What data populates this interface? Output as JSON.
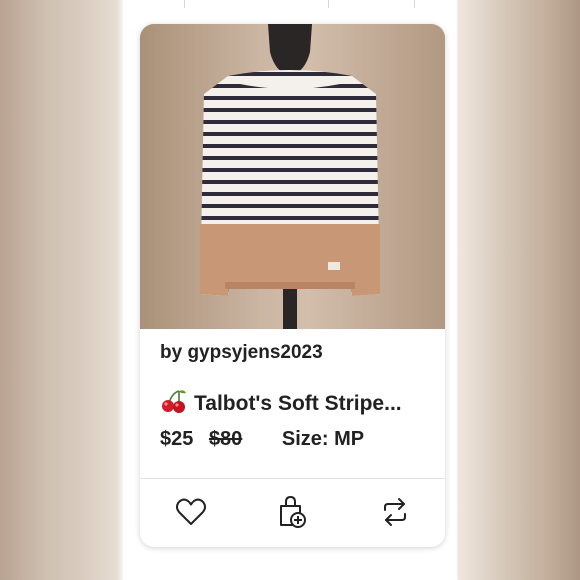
{
  "listing": {
    "seller": "by gypsyjens2023",
    "title_emoji": "cherry-icon",
    "title": "Talbot's Soft Stripe...",
    "price": "$25",
    "original_price": "$80",
    "size_label": "Size: MP"
  },
  "actions": [
    "like-heart-icon",
    "add-to-bundle-icon",
    "share-icon"
  ],
  "colors": {
    "sweater_stripe": "#2f2b3a",
    "sweater_base": "#f4f1ec",
    "sweater_hem": "#c89775",
    "mannequin": "#2a2626"
  }
}
